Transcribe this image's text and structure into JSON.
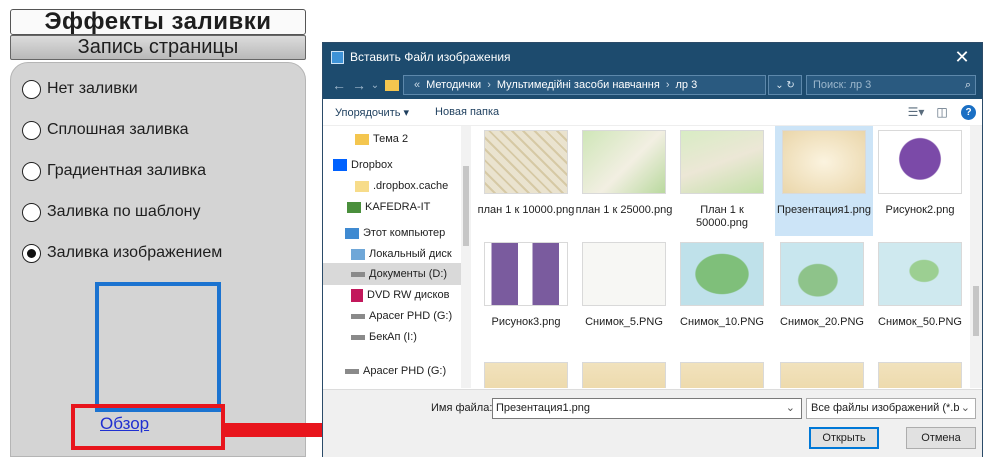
{
  "left_panel": {
    "title": "Эффекты заливки",
    "tab": "Запись страницы",
    "options": [
      {
        "label": "Нет заливки",
        "selected": false
      },
      {
        "label": "Сплошная заливка",
        "selected": false
      },
      {
        "label": "Градиентная заливка",
        "selected": false
      },
      {
        "label": "Заливка по шаблону",
        "selected": false
      },
      {
        "label": "Заливка изображением",
        "selected": true
      }
    ],
    "browse_label": "Обзор"
  },
  "dialog": {
    "title": "Вставить Файл изображения",
    "close_glyph": "✕",
    "path": [
      "Методички",
      "Мультимедійні засоби навчання",
      "лр 3"
    ],
    "search_placeholder": "Поиск: лр 3",
    "toolbar": {
      "organize": "Упорядочить ▾",
      "new_folder": "Новая папка"
    },
    "nav_items": [
      {
        "label": "Тема 2",
        "icon": "folder-icon"
      },
      {
        "label": "Dropbox",
        "icon": "dropbox-icon"
      },
      {
        "label": ".dropbox.cache",
        "icon": "folder-icon"
      },
      {
        "label": "KAFEDRA-IT",
        "icon": "network-user-icon"
      },
      {
        "label": "Этот компьютер",
        "icon": "computer-icon"
      },
      {
        "label": "Локальный диск",
        "icon": "disk-icon"
      },
      {
        "label": "Документы (D:)",
        "icon": "drive-icon",
        "selected": true
      },
      {
        "label": "DVD RW дисков",
        "icon": "dvd-icon"
      },
      {
        "label": "Apacer PHD (G:)",
        "icon": "drive-icon"
      },
      {
        "label": "БекАп (I:)",
        "icon": "drive-icon"
      },
      {
        "label": "Apacer PHD (G:)",
        "icon": "drive-icon"
      }
    ],
    "files": [
      {
        "name": "план 1 к 10000.png",
        "thumb": "map"
      },
      {
        "name": "план 1 к 25000.png",
        "thumb": "map"
      },
      {
        "name": "План 1 к 50000.png",
        "thumb": "map"
      },
      {
        "name": "Презентация1.png",
        "thumb": "parchment",
        "selected": true
      },
      {
        "name": "Рисунок2.png",
        "thumb": "cloud"
      },
      {
        "name": "Рисунок3.png",
        "thumb": "diagram"
      },
      {
        "name": "Снимок_5.PNG",
        "thumb": "sketch"
      },
      {
        "name": "Снимок_10.PNG",
        "thumb": "island"
      },
      {
        "name": "Снимок_20.PNG",
        "thumb": "island"
      },
      {
        "name": "Снимок_50.PNG",
        "thumb": "island"
      }
    ],
    "file_name_label": "Имя файла:",
    "file_name_value": "Презентация1.png",
    "file_type": "Все файлы изображений (*.bm",
    "open_button": "Открыть",
    "cancel_button": "Отмена"
  },
  "colors": {
    "dialog_titlebar": "#1d4b6e",
    "highlight_red": "#e8151c",
    "preview_blue": "#1b73d0",
    "selection": "#cce4f7"
  }
}
